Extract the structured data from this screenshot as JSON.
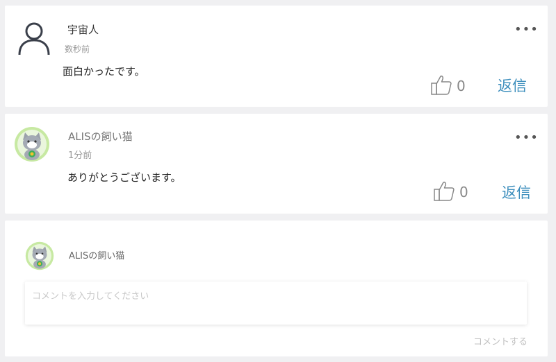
{
  "comments": [
    {
      "author": "宇宙人",
      "time": "数秒前",
      "body": "面白かったです。",
      "likes": "0",
      "reply_label": "返信",
      "more_label": "•••",
      "avatar": "default-user-icon"
    },
    {
      "author": "ALISの飼い猫",
      "time": "1分前",
      "body": "ありがとうございます。",
      "likes": "0",
      "reply_label": "返信",
      "more_label": "•••",
      "avatar": "cat-avatar"
    }
  ],
  "compose": {
    "author": "ALISの飼い猫",
    "placeholder": "コメントを入力してください",
    "submit_label": "コメントする"
  },
  "colors": {
    "reply": "#3e8fbd",
    "background": "#f0f0f2",
    "avatar_ring": "#a6d96a"
  }
}
